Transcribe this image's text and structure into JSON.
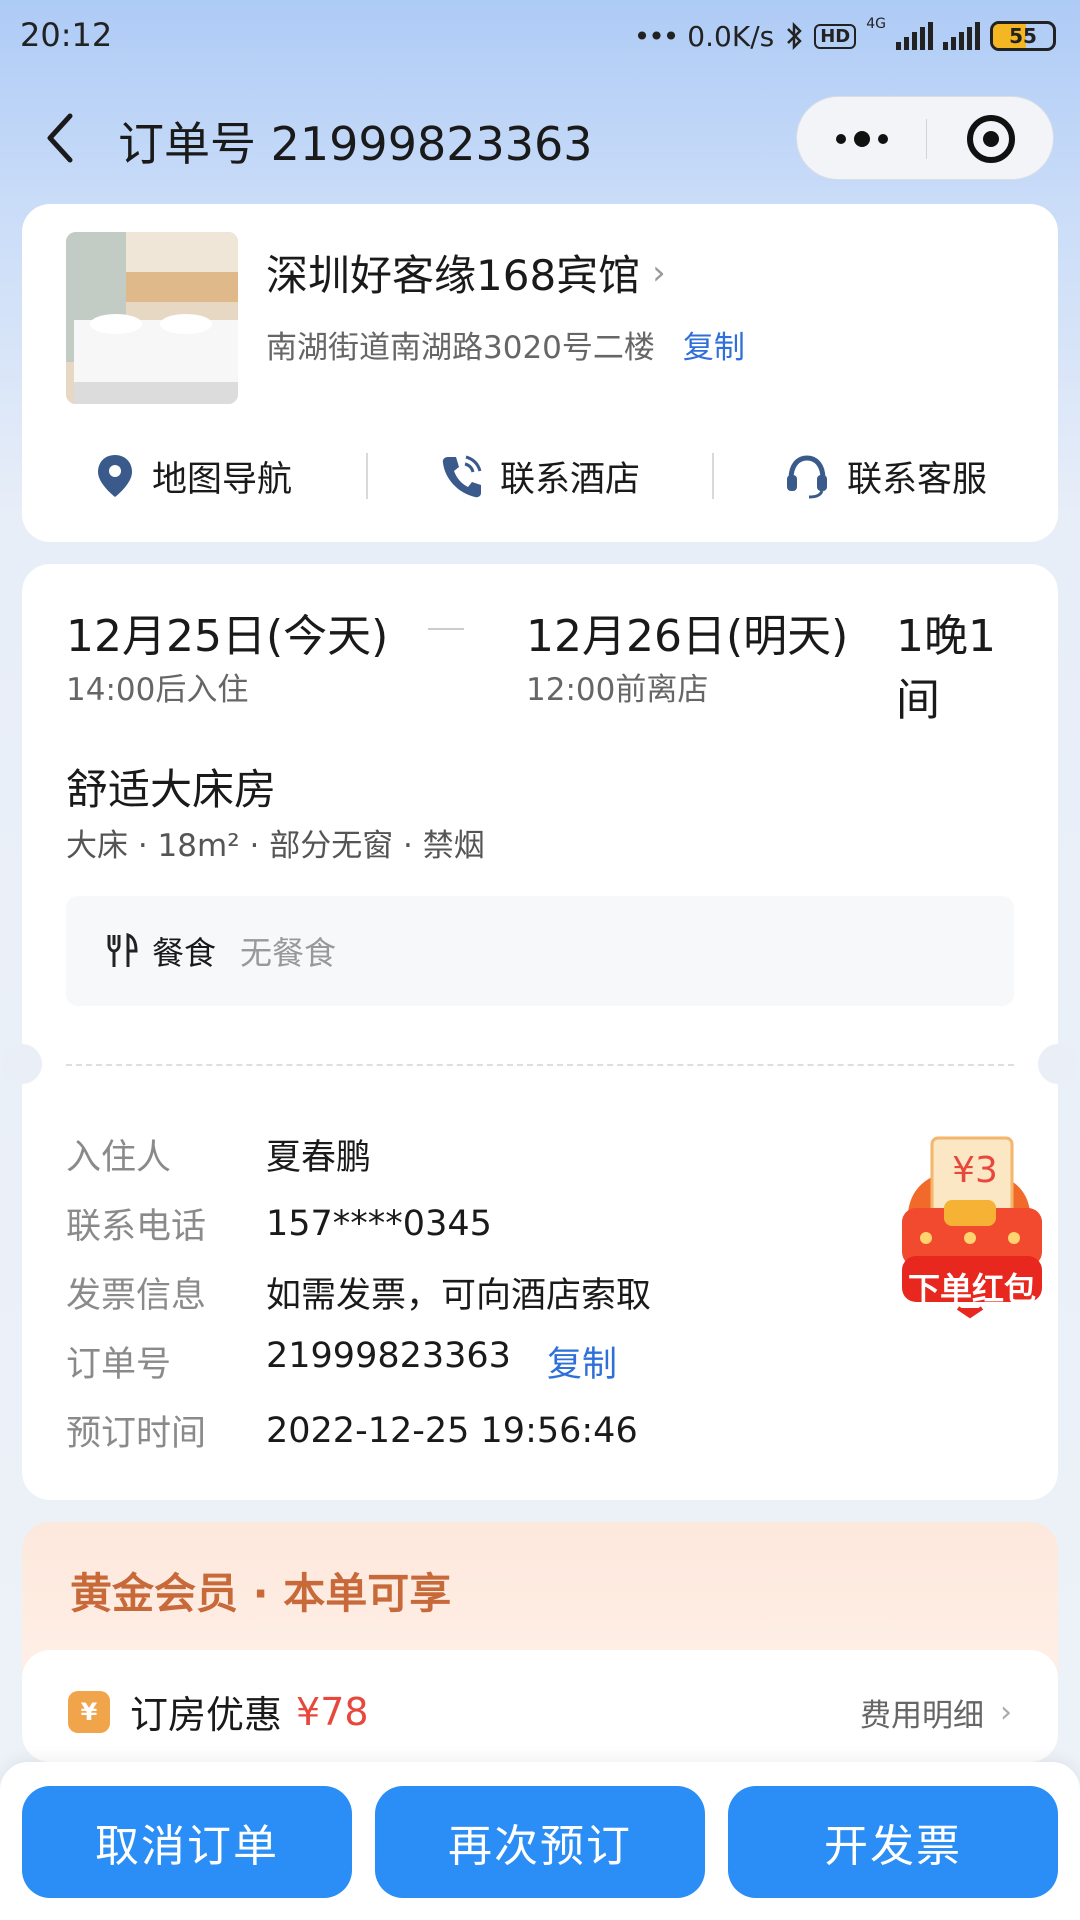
{
  "status_bar": {
    "time": "20:12",
    "network_speed": "0.0K/s",
    "hd_badge": "HD",
    "network_type": "4G",
    "battery": "55",
    "battery_fraction": 0.55
  },
  "nav": {
    "title": "订单号 21999823363",
    "icons": {
      "back": "chevron-left-icon",
      "more": "more-dots-icon",
      "close": "target-close-icon"
    }
  },
  "hotel": {
    "name": "深圳好客缘168宾馆",
    "address": "南湖街道南湖路3020号二楼",
    "copy_label": "复制",
    "actions": [
      {
        "label": "地图导航",
        "icon": "location-pin-icon"
      },
      {
        "label": "联系酒店",
        "icon": "phone-icon"
      },
      {
        "label": "联系客服",
        "icon": "headset-icon"
      }
    ]
  },
  "stay": {
    "checkin_date": "12月25日(今天)",
    "checkin_note": "14:00后入住",
    "checkout_date": "12月26日(明天)",
    "checkout_note": "12:00前离店",
    "nights_rooms": "1晚1间"
  },
  "room": {
    "name": "舒适大床房",
    "attributes": "大床 · 18m² · 部分无窗 · 禁烟",
    "meal_label": "餐食",
    "meal_value": "无餐食",
    "meal_icon": "fork-knife-icon"
  },
  "order_info": [
    {
      "label": "入住人",
      "value": "夏春鹏"
    },
    {
      "label": "联系电话",
      "value": "157****0345"
    },
    {
      "label": "发票信息",
      "value": "如需发票，可向酒店索取"
    },
    {
      "label": "订单号",
      "value": "21999823363",
      "action": "复制"
    },
    {
      "label": "预订时间",
      "value": "2022-12-25 19:56:46"
    }
  ],
  "red_packet": {
    "amount": "¥3",
    "label": "下单红包"
  },
  "member": {
    "title": "黄金会员 · 本单可享",
    "discount_label": "订房优惠",
    "discount_amount": "¥78",
    "fee_detail": "费用明细",
    "yen_icon_text": "¥"
  },
  "buttons": {
    "cancel": "取消订单",
    "rebook": "再次预订",
    "invoice": "开发票"
  },
  "colors": {
    "primary": "#2b8df6",
    "link": "#2f6fd9",
    "discount": "#e8483c",
    "member": "#c8693a"
  }
}
